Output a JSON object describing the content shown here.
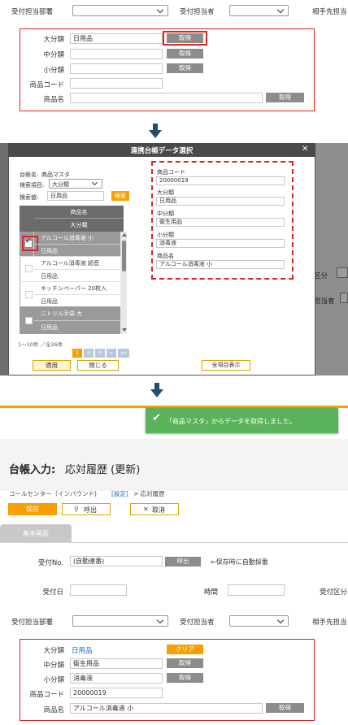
{
  "top": {
    "dept_label": "受付担当部署",
    "person_label": "受付担当者",
    "partner_label": "相手先担当",
    "fields": [
      {
        "label": "大分類",
        "value": "日用品",
        "btn": "取得"
      },
      {
        "label": "中分類",
        "value": "",
        "btn": "取得"
      },
      {
        "label": "小分類",
        "value": "",
        "btn": "取得"
      },
      {
        "label": "商品コード",
        "value": ""
      },
      {
        "label": "商品名",
        "value": "",
        "btn": "取得"
      }
    ]
  },
  "dialog": {
    "title": "連携台帳データ選択",
    "close": "✕",
    "ledger_label": "台帳名:",
    "ledger_value": "商品マスタ",
    "search_item_label": "検索項目:",
    "search_item_value": "大分類",
    "search_value_label": "検索値:",
    "search_value": "日用品",
    "search_btn": "検索",
    "table_headers": [
      "商品名",
      "大分類"
    ],
    "rows": [
      {
        "name": "アルコール消毒液 小",
        "cat": "日用品",
        "selected": true
      },
      {
        "name": "アルコール消毒液 超音",
        "cat": "日用品",
        "selected": false
      },
      {
        "name": "キッチンペーパー 20枚入",
        "cat": "日用品",
        "selected": false
      },
      {
        "name": "ニトリル手袋 大",
        "cat": "日用品",
        "selected": false
      }
    ],
    "pager_info": "1～10件 ／全26件",
    "pages": [
      "1",
      "2",
      "3",
      "»",
      "»»"
    ],
    "apply_btn": "適用",
    "close_btn": "閉じる",
    "all_items_btn": "全項目表示",
    "detail": [
      {
        "label": "商品コード",
        "value": "20000019"
      },
      {
        "label": "大分類",
        "value": "日用品"
      },
      {
        "label": "中分類",
        "value": "衛生用品"
      },
      {
        "label": "小分類",
        "value": "消毒液"
      },
      {
        "label": "商品名",
        "value": "アルコール消毒液 小"
      }
    ],
    "bg_right": [
      "区分",
      "担当者"
    ]
  },
  "toast": {
    "message": "「商品マスタ」からデータを取得しました。"
  },
  "page": {
    "title_bold": "台帳入力:",
    "title_rest": "応対履歴 (更新)",
    "breadcrumb_a": "コールセンター（インバウンド)",
    "breadcrumb_link": "[設定]",
    "breadcrumb_b": "> 応対履歴",
    "save_btn": "保存",
    "call_btn": "呼出",
    "cancel_btn": "取消",
    "tab": "基本画面",
    "recv_no_label": "受付No.",
    "recv_no_value": "(自動連番)",
    "recv_call_btn": "呼出",
    "recv_note": "←保存時に自動採番",
    "recv_date_label": "受付日",
    "time_label": "時間",
    "recv_type_label": "受付区分",
    "dept_label": "受付担当部署",
    "person_label": "受付担当者",
    "partner_label": "相手先担当",
    "fields": [
      {
        "label": "大分類",
        "value": "日用品",
        "btn": "クリア"
      },
      {
        "label": "中分類",
        "value": "衛生用品",
        "btn": "取得"
      },
      {
        "label": "小分類",
        "value": "消毒液",
        "btn": "取得"
      },
      {
        "label": "商品コード",
        "value": "20000019"
      },
      {
        "label": "商品名",
        "value": "アルコール消毒液 小",
        "btn": "取得"
      }
    ]
  },
  "colors": {
    "accent_orange": "#f5a000",
    "toast_green": "#5ab25a",
    "dialog_header": "#4a4a4a",
    "red_border": "#d22222",
    "arrow": "#1f4f6f"
  }
}
